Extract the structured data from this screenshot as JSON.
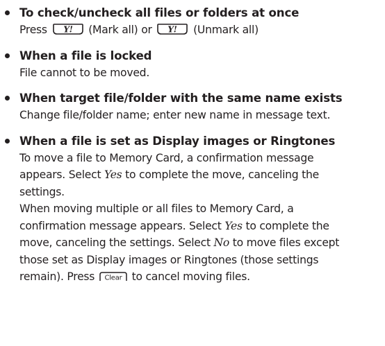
{
  "items": [
    {
      "heading": "To check/uncheck all files or folders at once",
      "lines": [
        {
          "pre": "Press ",
          "mid": " (Mark all) or ",
          "post": " (Unmark all)"
        }
      ]
    },
    {
      "heading": "When a file is locked",
      "lines": [
        "File cannot to be moved."
      ]
    },
    {
      "heading": "When target file/folder with the same name exists",
      "lines": [
        "Change file/folder name; enter new name in message text."
      ]
    },
    {
      "heading": "When a file is set as Display images or Ringtones",
      "lines": [
        "To move a file to Memory Card, a confirmation message",
        {
          "pre": "appears. Select ",
          "em": "Yes",
          "post": " to complete the move, canceling the"
        },
        "settings.",
        "When moving multiple or all files to Memory Card, a",
        {
          "pre": "confirmation message appears. Select ",
          "em": "Yes",
          "post": " to complete the"
        },
        {
          "pre": "move, canceling the settings. Select ",
          "em": "No",
          "post": " to move files except"
        },
        "those set as Display images or Ringtones (those settings",
        {
          "pre": "remain). Press ",
          "post": " to cancel moving files."
        }
      ]
    }
  ],
  "icons": {
    "softkey": "yahoo-softkey-icon",
    "softkey_label": "Y!",
    "clear": "clear-key-icon",
    "clear_label": "Clear"
  }
}
